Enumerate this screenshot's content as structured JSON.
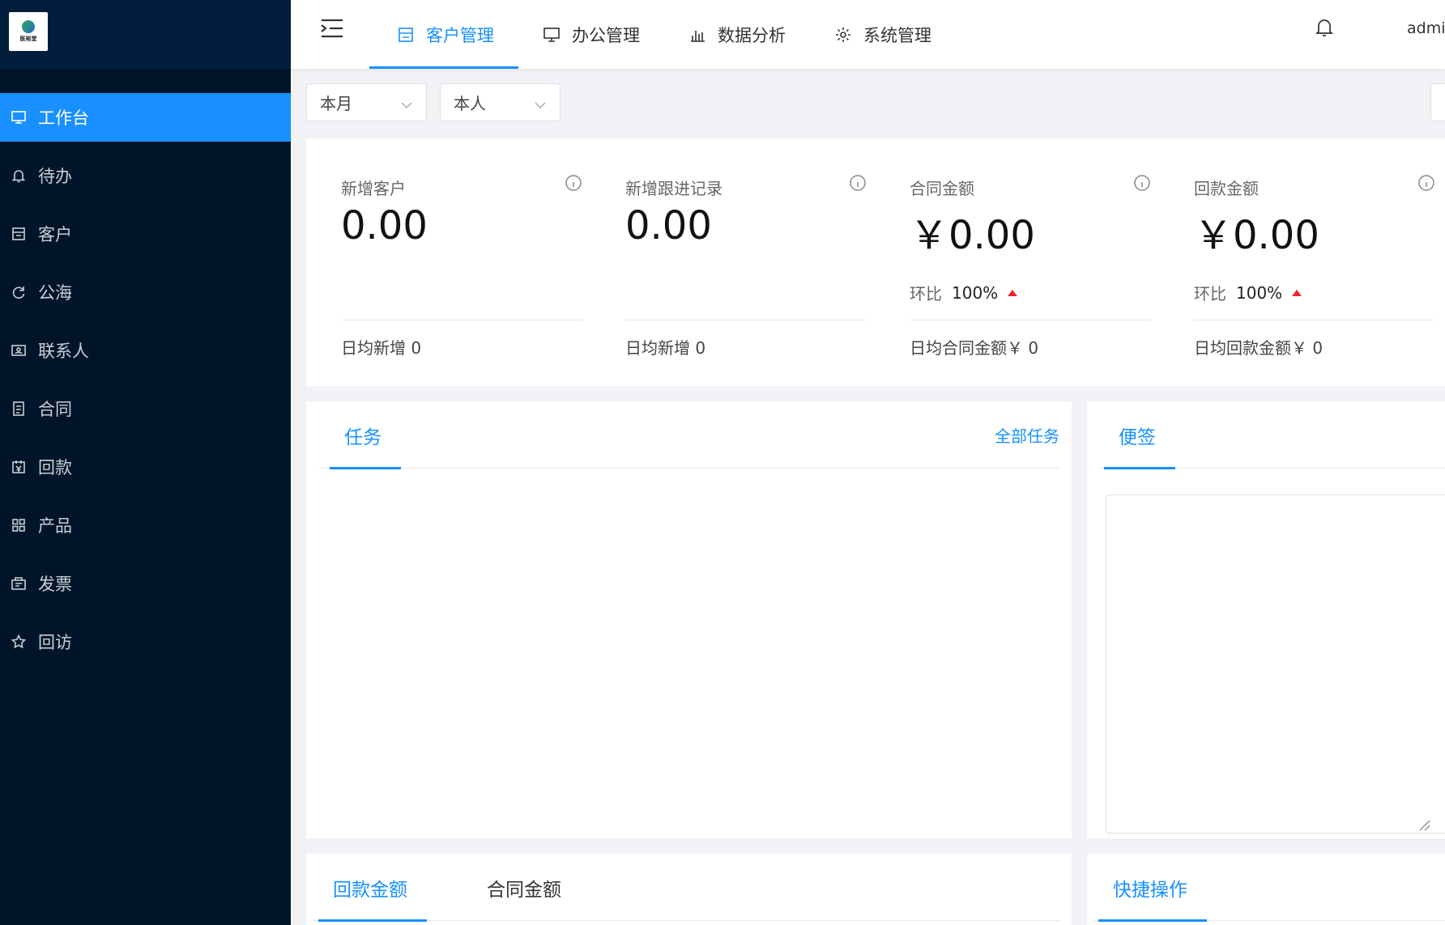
{
  "app": {
    "logo_text": "医裕堂"
  },
  "sidebar": {
    "items": [
      {
        "label": "工作台",
        "icon": "monitor-icon",
        "active": true
      },
      {
        "label": "待办",
        "icon": "bell-icon"
      },
      {
        "label": "客户",
        "icon": "store-icon"
      },
      {
        "label": "公海",
        "icon": "refresh-icon"
      },
      {
        "label": "联系人",
        "icon": "contact-card-icon"
      },
      {
        "label": "合同",
        "icon": "document-icon"
      },
      {
        "label": "回款",
        "icon": "payment-icon"
      },
      {
        "label": "产品",
        "icon": "grid-icon"
      },
      {
        "label": "发票",
        "icon": "invoice-icon"
      },
      {
        "label": "回访",
        "icon": "star-icon"
      }
    ]
  },
  "topbar": {
    "tabs": [
      {
        "label": "客户管理",
        "icon": "store-icon",
        "active": true
      },
      {
        "label": "办公管理",
        "icon": "monitor-icon"
      },
      {
        "label": "数据分析",
        "icon": "bar-chart-icon"
      },
      {
        "label": "系统管理",
        "icon": "gear-icon"
      }
    ],
    "user": "admin"
  },
  "filters": {
    "period": "本月",
    "scope": "本人"
  },
  "stats": [
    {
      "title": "新增客户",
      "value": "0.00",
      "foot": "日均新增 0"
    },
    {
      "title": "新增跟进记录",
      "value": "0.00",
      "foot": "日均新增 0"
    },
    {
      "title": "合同金额",
      "value": "￥0.00",
      "ratio_label": "环比",
      "ratio_value": "100%",
      "foot": "日均合同金额￥ 0"
    },
    {
      "title": "回款金额",
      "value": "￥0.00",
      "ratio_label": "环比",
      "ratio_value": "100%",
      "foot": "日均回款金额￥ 0"
    }
  ],
  "tasks": {
    "title": "任务",
    "link": "全部任务"
  },
  "notes": {
    "title": "便签"
  },
  "amount_tabs": [
    {
      "label": "回款金额",
      "active": true
    },
    {
      "label": "合同金额"
    }
  ],
  "quick_ops": {
    "title": "快捷操作"
  },
  "colors": {
    "primary": "#1890ff",
    "sidebar_bg": "#001529",
    "up": "#f5222d"
  }
}
